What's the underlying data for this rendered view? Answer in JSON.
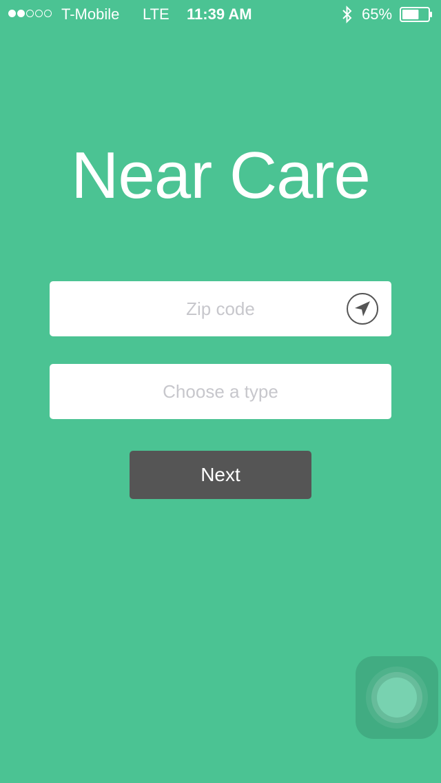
{
  "status_bar": {
    "signal_bars_filled": 2,
    "signal_bars_total": 5,
    "carrier": "T-Mobile",
    "network": "LTE",
    "time": "11:39 AM",
    "bluetooth_icon": "bluetooth-icon",
    "battery_percent": "65%",
    "battery_level": 0.65
  },
  "app": {
    "title": "Near Care"
  },
  "form": {
    "zip_placeholder": "Zip code",
    "zip_value": "",
    "location_icon": "location-arrow-icon",
    "type_placeholder": "Choose a type",
    "next_label": "Next"
  },
  "colors": {
    "background": "#4BC393",
    "button": "#555555",
    "field": "#FFFFFF",
    "placeholder": "#C7C7CC"
  }
}
